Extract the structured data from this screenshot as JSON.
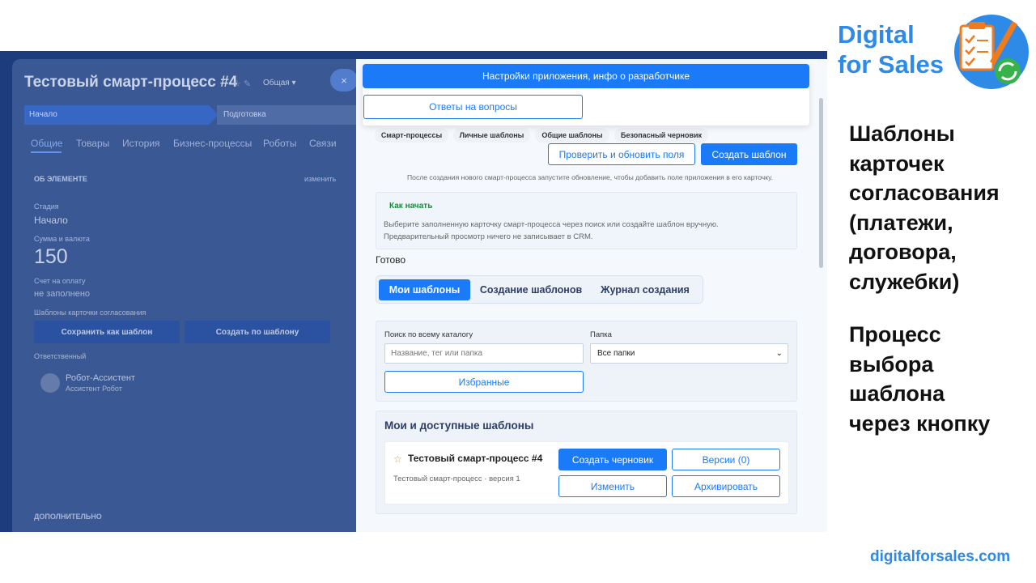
{
  "background_card": {
    "title": "Тестовый смарт-процесс #4",
    "title_scope": "Общая",
    "close": "×",
    "stages": [
      "Начало",
      "Подготовка"
    ],
    "tabs": [
      "Общие",
      "Товары",
      "История",
      "Бизнес-процессы",
      "Роботы",
      "Связи"
    ],
    "section_title": "ОБ ЭЛЕМЕНТЕ",
    "section_action": "изменить",
    "stage_label": "Стадия",
    "stage_value": "Начало",
    "amount_label": "Сумма и валюта",
    "amount_value": "150",
    "invoice_label": "Счет на оплату",
    "invoice_value": "не заполнено",
    "templates_label": "Шаблоны карточки согласования",
    "save_as_template": "Сохранить как шаблон",
    "create_by_template": "Создать по шаблону",
    "responsible_label": "Ответственный",
    "assistant_name": "Робот-Ассистент",
    "assistant_role": "Ассистент Робот",
    "extra_label": "ДОПОЛНИТЕЛЬНО"
  },
  "dropdown": {
    "settings_label": "Настройки приложения, инфо о разработчике",
    "faq_label": "Ответы на вопросы"
  },
  "chips": [
    "Смарт-процессы",
    "Личные шаблоны",
    "Общие шаблоны",
    "Безопасный черновик"
  ],
  "toolbar": {
    "check_label": "Проверить и обновить поля",
    "create_template_label": "Создать шаблон",
    "hint": "После создания нового смарт-процесса запустите обновление, чтобы добавить поле приложения в его карточку."
  },
  "how_to": {
    "title": "Как начать",
    "line1": "Выберите заполненную карточку смарт-процесса через поиск или создайте шаблон вручную.",
    "line2": "Предварительный просмотр ничего не записывает в CRM."
  },
  "status": "Готово",
  "tabs": {
    "my": "Мои шаблоны",
    "create": "Создание шаблонов",
    "log": "Журнал создания"
  },
  "search": {
    "label": "Поиск по всему каталогу",
    "placeholder": "Название, тег или папка",
    "folder_label": "Папка",
    "folder_value": "Все папки",
    "favorites_label": "Избранные"
  },
  "templates_list": {
    "title": "Мои и доступные шаблоны",
    "items": [
      {
        "name": "Тестовый смарт-процесс #4",
        "subtitle": "Тестовый смарт-процесс · версия 1",
        "draft_label": "Создать черновик",
        "versions_label": "Версии (0)",
        "edit_label": "Изменить",
        "archive_label": "Архивировать"
      }
    ]
  },
  "brand": {
    "line1": "Digital",
    "line2": "for Sales",
    "site": "digitalforsales.com",
    "color": "#2d8ae6"
  },
  "headline1": [
    "Шаблоны",
    "карточек",
    "согласования",
    "(платежи,",
    "договора,",
    "служебки)"
  ],
  "headline2": [
    "Процесс",
    "выбора",
    "шаблона",
    "через кнопку"
  ],
  "colors": {
    "accent": "#1a7af8",
    "overlay": "#1f3f80",
    "success": "#198a3f"
  }
}
